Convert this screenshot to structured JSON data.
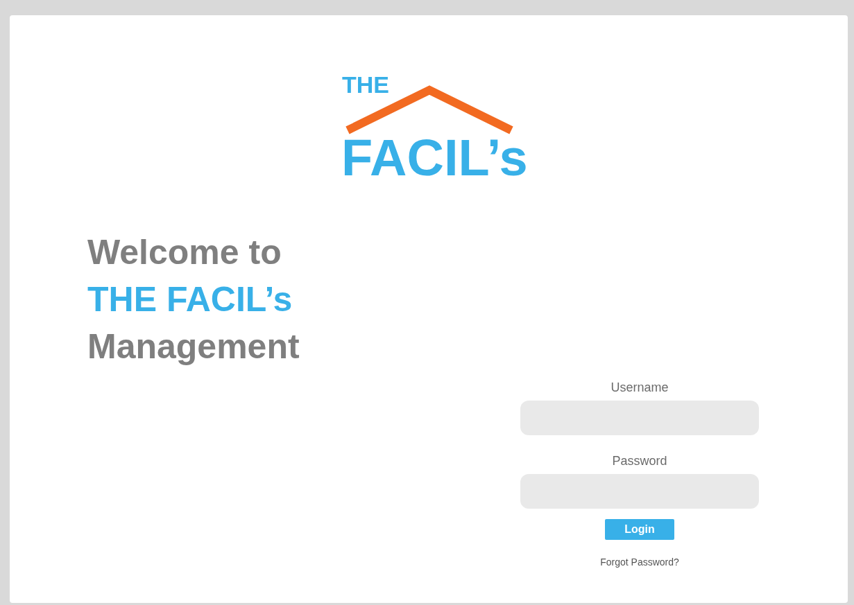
{
  "logo": {
    "top_word": "THE",
    "name": "FACIL’s"
  },
  "welcome": [
    {
      "text": "Welcome to",
      "kind": "plain"
    },
    {
      "text": "THE FACIL’s",
      "kind": "accent"
    },
    {
      "text": "Management",
      "kind": "plain"
    }
  ],
  "login_form": {
    "fields": [
      {
        "label": "Username"
      },
      {
        "label": "Password"
      }
    ],
    "button": "Login",
    "link": "Forgot Password?"
  }
}
